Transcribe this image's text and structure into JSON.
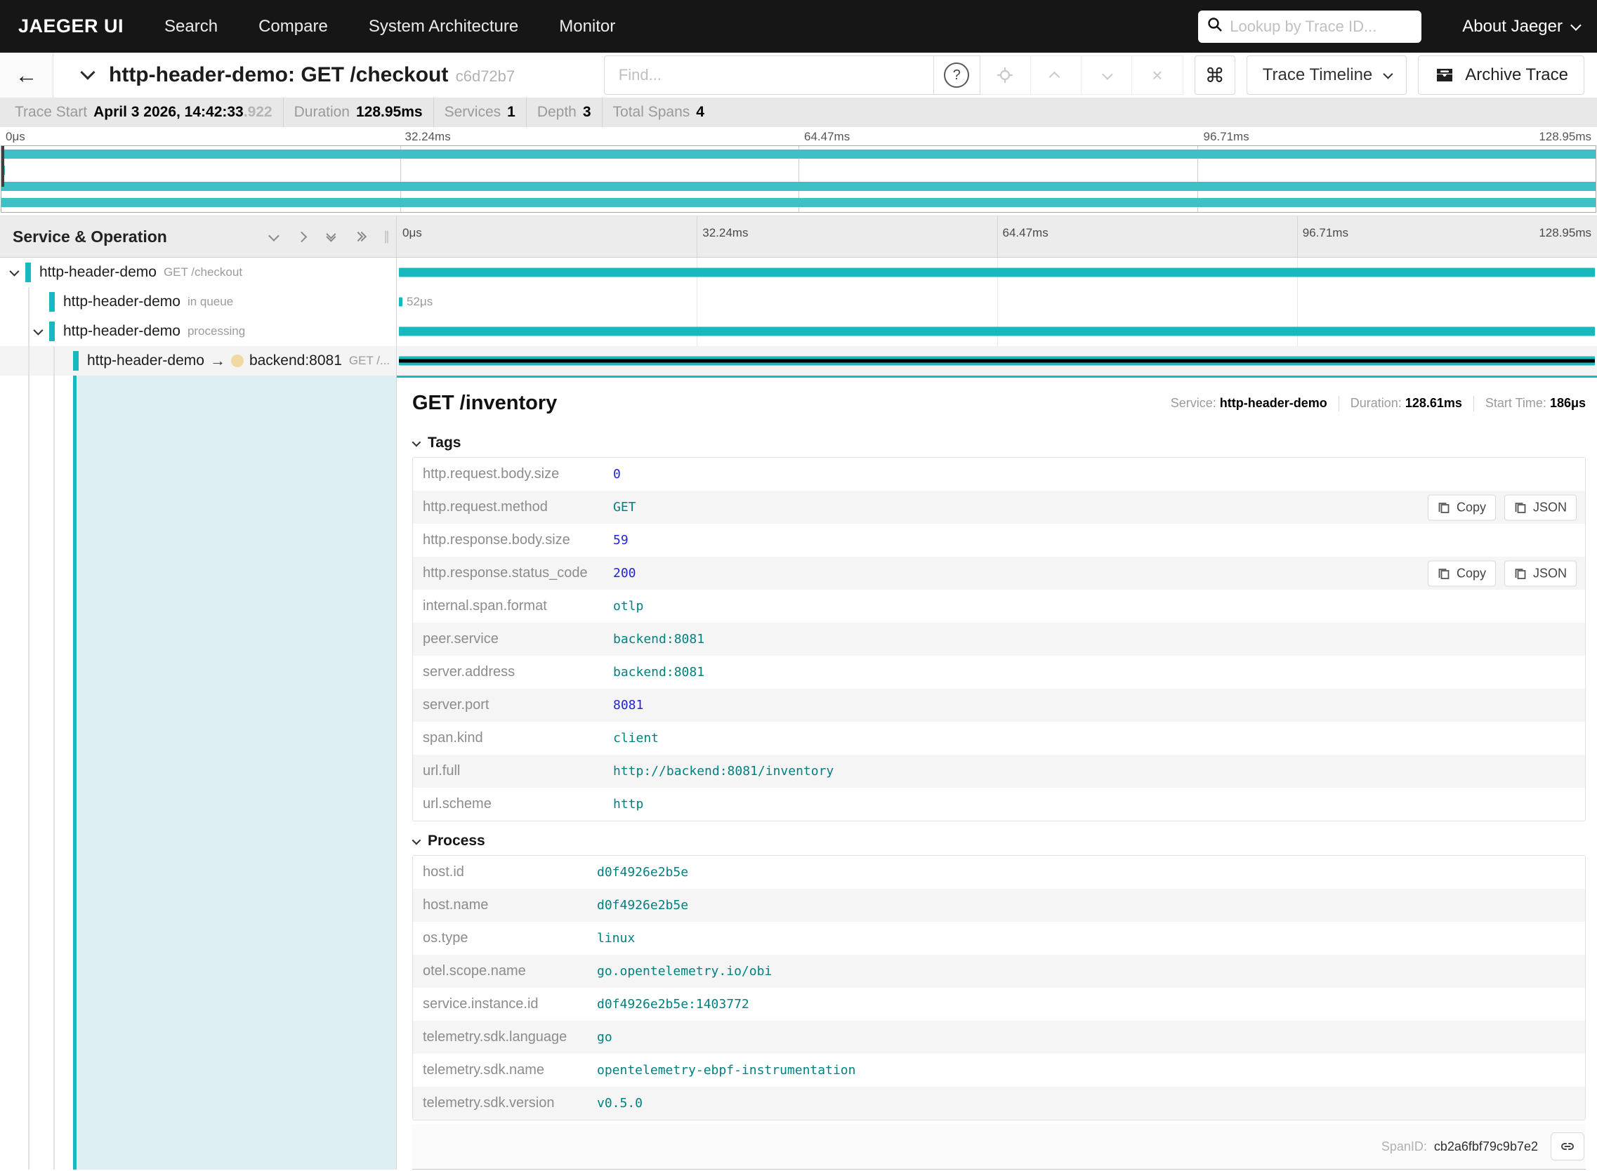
{
  "nav": {
    "brand": "JAEGER UI",
    "items": [
      {
        "label": "Search"
      },
      {
        "label": "Compare"
      },
      {
        "label": "System Architecture"
      },
      {
        "label": "Monitor"
      }
    ],
    "search_placeholder": "Lookup by Trace ID...",
    "about_label": "About Jaeger"
  },
  "tracebar": {
    "title": "http-header-demo: GET /checkout",
    "trace_id_short": "c6d72b7",
    "find_placeholder": "Find...",
    "help_glyph": "?",
    "command_glyph": "⌘",
    "view_select_label": "Trace Timeline",
    "archive_label": "Archive Trace"
  },
  "summary": {
    "items": [
      {
        "label": "Trace Start",
        "value": "April 3 2026, 14:42:33",
        "suffix": ".922"
      },
      {
        "label": "Duration",
        "value": "128.95ms",
        "suffix": ""
      },
      {
        "label": "Services",
        "value": "1",
        "suffix": ""
      },
      {
        "label": "Depth",
        "value": "3",
        "suffix": ""
      },
      {
        "label": "Total Spans",
        "value": "4",
        "suffix": ""
      }
    ]
  },
  "timeline": {
    "ticks": [
      "0μs",
      "32.24ms",
      "64.47ms",
      "96.71ms",
      "128.95ms"
    ],
    "left_header": "Service & Operation"
  },
  "spans": [
    {
      "service": "http-header-demo",
      "operation": "GET /checkout"
    },
    {
      "service": "http-header-demo",
      "operation": "in queue",
      "duration_label": "52μs"
    },
    {
      "service": "http-header-demo",
      "operation": "processing"
    },
    {
      "service": "http-header-demo",
      "operation": "GET /...",
      "arrow": "→",
      "peer": "backend:8081"
    }
  ],
  "detail": {
    "title": "GET /inventory",
    "meta": [
      {
        "label": "Service:",
        "value": "http-header-demo"
      },
      {
        "label": "Duration:",
        "value": "128.61ms"
      },
      {
        "label": "Start Time:",
        "value": "186μs"
      }
    ],
    "tags_header": "Tags",
    "actions": {
      "copy": "Copy",
      "json": "JSON"
    },
    "tags": [
      {
        "key": "http.request.body.size",
        "value": "0"
      },
      {
        "key": "http.request.method",
        "value": "GET"
      },
      {
        "key": "http.response.body.size",
        "value": "59"
      },
      {
        "key": "http.response.status_code",
        "value": "200"
      },
      {
        "key": "internal.span.format",
        "value": "otlp"
      },
      {
        "key": "peer.service",
        "value": "backend:8081"
      },
      {
        "key": "server.address",
        "value": "backend:8081"
      },
      {
        "key": "server.port",
        "value": "8081"
      },
      {
        "key": "span.kind",
        "value": "client"
      },
      {
        "key": "url.full",
        "value": "http://backend:8081/inventory"
      },
      {
        "key": "url.scheme",
        "value": "http"
      }
    ],
    "process_header": "Process",
    "process": [
      {
        "key": "host.id",
        "value": "d0f4926e2b5e"
      },
      {
        "key": "host.name",
        "value": "d0f4926e2b5e"
      },
      {
        "key": "os.type",
        "value": "linux"
      },
      {
        "key": "otel.scope.name",
        "value": "go.opentelemetry.io/obi"
      },
      {
        "key": "service.instance.id",
        "value": "d0f4926e2b5e:1403772"
      },
      {
        "key": "telemetry.sdk.language",
        "value": "go"
      },
      {
        "key": "telemetry.sdk.name",
        "value": "opentelemetry-ebpf-instrumentation"
      },
      {
        "key": "telemetry.sdk.version",
        "value": "v0.5.0"
      }
    ],
    "span_id_label": "SpanID:",
    "span_id": "cb2a6fbf79c9b7e2"
  }
}
